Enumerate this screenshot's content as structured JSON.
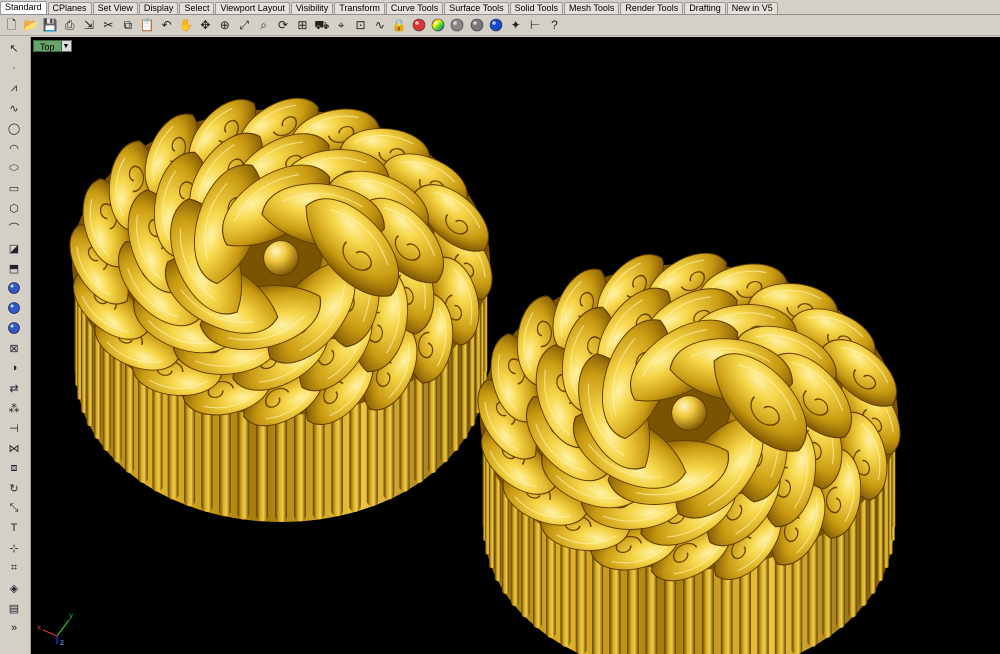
{
  "tabs": [
    "Standard",
    "CPlanes",
    "Set View",
    "Display",
    "Select",
    "Viewport Layout",
    "Visibility",
    "Transform",
    "Curve Tools",
    "Surface Tools",
    "Solid Tools",
    "Mesh Tools",
    "Render Tools",
    "Drafting",
    "New in V5"
  ],
  "active_tab": "Standard",
  "toolbar_icons": [
    "new-file-icon",
    "open-folder-icon",
    "save-icon",
    "print-icon",
    "import-icon",
    "cut-icon",
    "copy-icon",
    "paste-icon",
    "undo-icon",
    "pan-hand-icon",
    "move-cross-icon",
    "zoom-window-icon",
    "zoom-extents-icon",
    "zoom-selected-icon",
    "rotate-view-icon",
    "four-viewports-icon",
    "car-icon",
    "set-cplane-icon",
    "grid-icon",
    "curve-icon",
    "lock-icon",
    "material-ball-icon",
    "color-wheel-icon",
    "shade-sphere-icon",
    "render-sphere-icon",
    "blue-sphere-icon",
    "light-icon",
    "dimension-icon",
    "help-icon"
  ],
  "left_icons": [
    "select-arrow-icon",
    "point-icon",
    "polyline-icon",
    "curve-icon",
    "circle-icon",
    "arc-icon",
    "ellipse-icon",
    "rectangle-icon",
    "polygon-icon",
    "fillet-curve-icon",
    "surface-icon",
    "extrude-icon",
    "box-solid-icon",
    "sphere-solid-icon",
    "cylinder-solid-icon",
    "mesh-icon",
    "boolean-icon",
    "transform-icon",
    "array-icon",
    "split-icon",
    "join-icon",
    "group-icon",
    "rotate-icon",
    "scale-icon",
    "text-icon",
    "snap-icon",
    "analyze-icon",
    "render-icon",
    "block-icon",
    "more-icon"
  ],
  "viewport": {
    "title": "Top",
    "dropdown_glyph": "▼",
    "axis": {
      "x": "x",
      "y": "y",
      "z": "z"
    }
  },
  "more_glyph": "»",
  "colors": {
    "viewport_bg": "#000000",
    "ui_bg": "#d4d0c8",
    "gold_light": "#f6d64a",
    "gold_mid": "#c99b12",
    "gold_dark": "#6b4600",
    "viewport_label_bg": "#68a36a"
  }
}
